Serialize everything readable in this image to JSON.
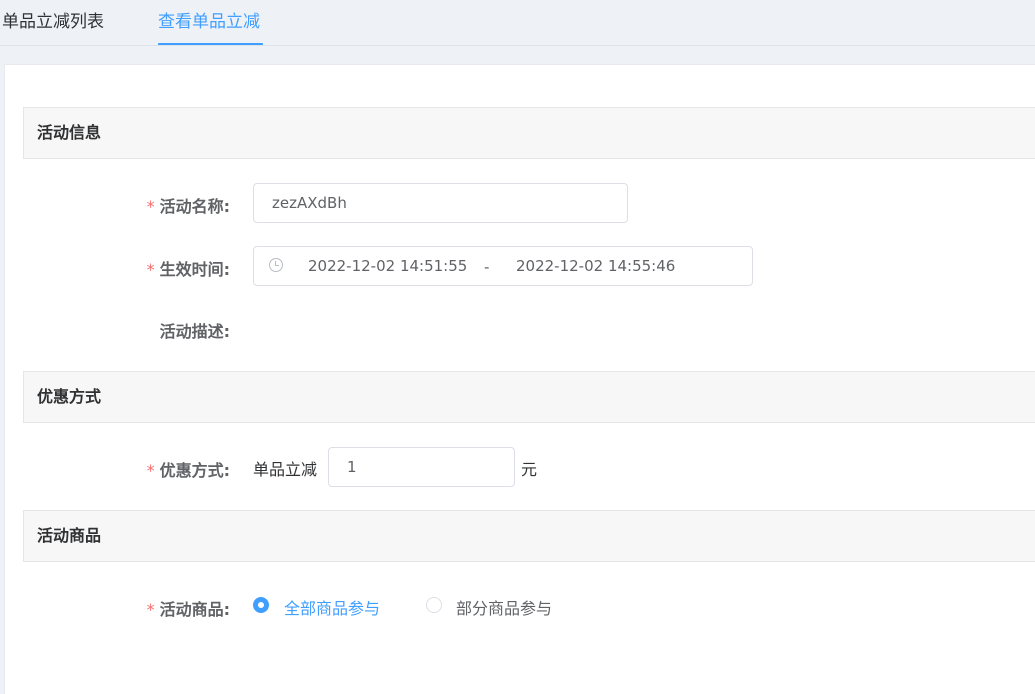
{
  "tabs": [
    {
      "label": "单品立减列表"
    },
    {
      "label": "查看单品立减",
      "active": true
    }
  ],
  "sections": {
    "info": "活动信息",
    "discount": "优惠方式",
    "goods": "活动商品"
  },
  "form": {
    "required_mark": "*",
    "name": {
      "label": "活动名称:",
      "value": "zezAXdBh"
    },
    "time": {
      "label": "生效时间:",
      "start": "2022-12-02 14:51:55",
      "separator": "-",
      "end": "2022-12-02 14:55:46"
    },
    "desc": {
      "label": "活动描述:"
    },
    "discount": {
      "label": "优惠方式:",
      "prefix": "单品立减",
      "value": "1",
      "unit": "元"
    },
    "goods": {
      "label": "活动商品:",
      "options": [
        {
          "label": "全部商品参与",
          "selected": true
        },
        {
          "label": "部分商品参与",
          "selected": false
        }
      ]
    }
  },
  "colors": {
    "accent": "#409eff",
    "required": "#f56c6c"
  }
}
